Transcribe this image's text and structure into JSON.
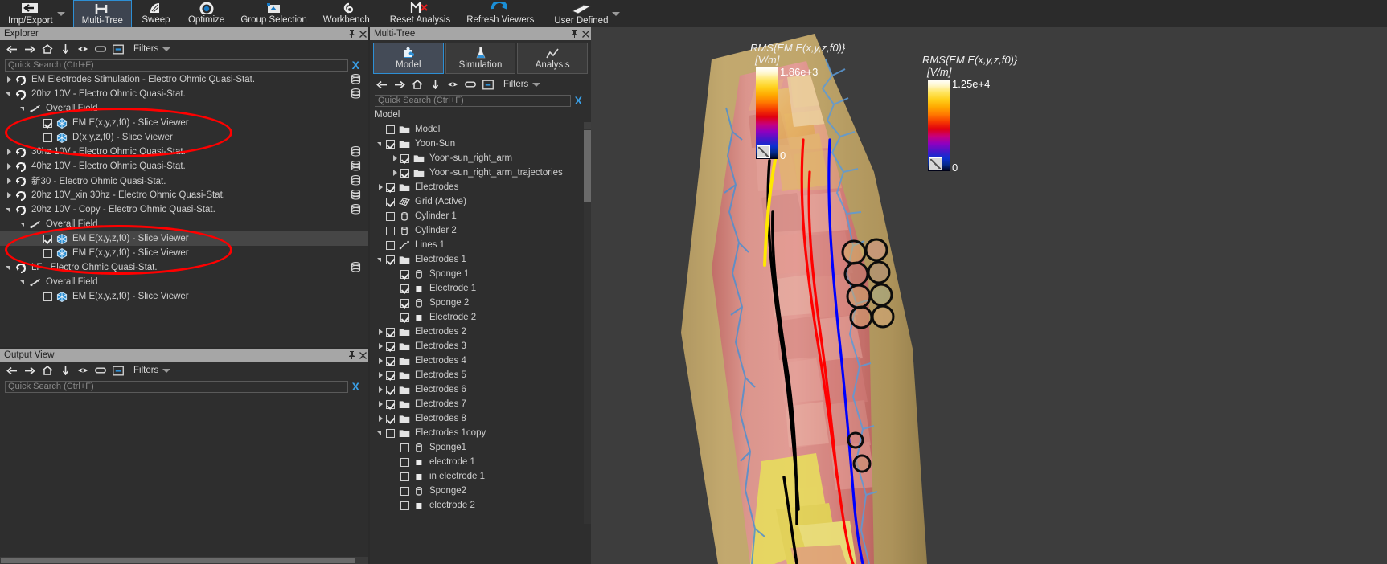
{
  "ribbon": {
    "items": [
      {
        "label": "Imp/Export",
        "icon": "import-export-icon",
        "caret": true,
        "active": false
      },
      {
        "label": "Multi-Tree",
        "icon": "multi-tree-icon",
        "caret": false,
        "active": true
      },
      {
        "label": "Sweep",
        "icon": "sweep-icon",
        "caret": false,
        "active": false
      },
      {
        "label": "Optimize",
        "icon": "optimize-icon",
        "caret": false,
        "active": false
      },
      {
        "label": "Group Selection",
        "icon": "group-selection-icon",
        "caret": false,
        "active": false
      },
      {
        "label": "Workbench",
        "icon": "workbench-icon",
        "caret": false,
        "active": false
      },
      {
        "label": "Reset Analysis",
        "icon": "reset-analysis-icon",
        "caret": false,
        "active": false
      },
      {
        "label": "Refresh Viewers",
        "icon": "refresh-viewers-icon",
        "caret": false,
        "active": false
      },
      {
        "label": "User Defined",
        "icon": "user-defined-icon",
        "caret": true,
        "active": false
      }
    ]
  },
  "explorer": {
    "title": "Explorer",
    "search": {
      "placeholder": "Quick Search (Ctrl+F)",
      "value": "",
      "clear_label": "X"
    },
    "toolbar": {
      "filters_label": "Filters"
    },
    "rows": [
      {
        "indent": 0,
        "twisty": "right",
        "check": "none",
        "icon": "simulation-icon",
        "label": "EM Electrodes Stimulation - Electro Ohmic Quasi-Stat.",
        "db": true,
        "selected": false
      },
      {
        "indent": 0,
        "twisty": "down",
        "check": "none",
        "icon": "simulation-icon",
        "label": "20hz 10V - Electro Ohmic Quasi-Stat.",
        "db": true,
        "selected": false
      },
      {
        "indent": 1,
        "twisty": "down",
        "check": "none",
        "icon": "field-icon",
        "label": "Overall Field",
        "db": false,
        "selected": false
      },
      {
        "indent": 2,
        "twisty": "none",
        "check": "on",
        "icon": "slice-viewer-icon",
        "label": "EM E(x,y,z,f0) - Slice Viewer",
        "db": false,
        "selected": false
      },
      {
        "indent": 2,
        "twisty": "none",
        "check": "off",
        "icon": "slice-viewer-icon",
        "label": "D(x,y,z,f0) - Slice Viewer",
        "db": false,
        "selected": false
      },
      {
        "indent": 0,
        "twisty": "right",
        "check": "none",
        "icon": "simulation-icon",
        "label": "30hz 10V - Electro Ohmic Quasi-Stat.",
        "db": true,
        "selected": false
      },
      {
        "indent": 0,
        "twisty": "right",
        "check": "none",
        "icon": "simulation-icon",
        "label": "40hz 10V  - Electro Ohmic Quasi-Stat.",
        "db": true,
        "selected": false
      },
      {
        "indent": 0,
        "twisty": "right",
        "check": "none",
        "icon": "simulation-icon",
        "label": "新30 - Electro Ohmic Quasi-Stat.",
        "db": true,
        "selected": false
      },
      {
        "indent": 0,
        "twisty": "right",
        "check": "none",
        "icon": "simulation-icon",
        "label": "20hz 10V_xin 30hz - Electro Ohmic Quasi-Stat.",
        "db": true,
        "selected": false
      },
      {
        "indent": 0,
        "twisty": "down",
        "check": "none",
        "icon": "simulation-icon",
        "label": "20hz 10V - Copy - Electro Ohmic Quasi-Stat.",
        "db": true,
        "selected": false
      },
      {
        "indent": 1,
        "twisty": "down",
        "check": "none",
        "icon": "field-icon",
        "label": "Overall Field",
        "db": false,
        "selected": false
      },
      {
        "indent": 2,
        "twisty": "none",
        "check": "on",
        "icon": "slice-viewer-icon",
        "label": "EM E(x,y,z,f0) - Slice Viewer",
        "db": false,
        "selected": true
      },
      {
        "indent": 2,
        "twisty": "none",
        "check": "off",
        "icon": "slice-viewer-icon",
        "label": "EM E(x,y,z,f0) - Slice Viewer",
        "db": false,
        "selected": false
      },
      {
        "indent": 0,
        "twisty": "down",
        "check": "none",
        "icon": "simulation-icon",
        "label": "LF - Electro Ohmic Quasi-Stat.",
        "db": true,
        "selected": false
      },
      {
        "indent": 1,
        "twisty": "down",
        "check": "none",
        "icon": "field-icon",
        "label": "Overall Field",
        "db": false,
        "selected": false
      },
      {
        "indent": 2,
        "twisty": "none",
        "check": "off",
        "icon": "slice-viewer-icon",
        "label": "EM E(x,y,z,f0) - Slice Viewer",
        "db": false,
        "selected": false
      }
    ]
  },
  "output_view": {
    "title": "Output View",
    "search": {
      "placeholder": "Quick Search (Ctrl+F)",
      "value": "",
      "clear_label": "X"
    },
    "toolbar": {
      "filters_label": "Filters"
    }
  },
  "multi_tree": {
    "title": "Multi-Tree",
    "tabs": [
      {
        "label": "Model",
        "icon": "puzzle-icon",
        "active": true
      },
      {
        "label": "Simulation",
        "icon": "flask-icon",
        "active": false
      },
      {
        "label": "Analysis",
        "icon": "analysis-icon",
        "active": false
      }
    ],
    "toolbar": {
      "filters_label": "Filters"
    },
    "search": {
      "placeholder": "Quick Search (Ctrl+F)",
      "value": "",
      "clear_label": "X"
    },
    "header": "Model",
    "rows": [
      {
        "indent": 0,
        "twisty": "none",
        "check": "off",
        "icon": "folder-icon",
        "label": "Model"
      },
      {
        "indent": 0,
        "twisty": "down",
        "check": "on",
        "icon": "folder-icon",
        "label": "Yoon-Sun"
      },
      {
        "indent": 1,
        "twisty": "right",
        "check": "on",
        "icon": "folder-icon",
        "label": "Yoon-sun_right_arm"
      },
      {
        "indent": 1,
        "twisty": "right",
        "check": "on",
        "icon": "folder-icon",
        "label": "Yoon-sun_right_arm_trajectories"
      },
      {
        "indent": 0,
        "twisty": "right",
        "check": "on",
        "icon": "folder-icon",
        "label": "Electrodes"
      },
      {
        "indent": 0,
        "twisty": "none",
        "check": "on",
        "icon": "grid-icon",
        "label": "Grid (Active)"
      },
      {
        "indent": 0,
        "twisty": "none",
        "check": "off",
        "icon": "cylinder-icon",
        "label": "Cylinder 1"
      },
      {
        "indent": 0,
        "twisty": "none",
        "check": "off",
        "icon": "cylinder-icon",
        "label": "Cylinder 2"
      },
      {
        "indent": 0,
        "twisty": "none",
        "check": "off",
        "icon": "lines-icon",
        "label": "Lines 1"
      },
      {
        "indent": 0,
        "twisty": "down",
        "check": "on",
        "icon": "folder-icon",
        "label": "Electrodes 1"
      },
      {
        "indent": 1,
        "twisty": "none",
        "check": "on",
        "icon": "cylinder-icon",
        "label": "Sponge 1"
      },
      {
        "indent": 1,
        "twisty": "none",
        "check": "on",
        "icon": "block-icon",
        "label": "Electrode 1"
      },
      {
        "indent": 1,
        "twisty": "none",
        "check": "on",
        "icon": "cylinder-icon",
        "label": "Sponge 2"
      },
      {
        "indent": 1,
        "twisty": "none",
        "check": "on",
        "icon": "block-icon",
        "label": "Electrode 2"
      },
      {
        "indent": 0,
        "twisty": "right",
        "check": "on",
        "icon": "folder-icon",
        "label": "Electrodes 2"
      },
      {
        "indent": 0,
        "twisty": "right",
        "check": "on",
        "icon": "folder-icon",
        "label": "Electrodes 3"
      },
      {
        "indent": 0,
        "twisty": "right",
        "check": "on",
        "icon": "folder-icon",
        "label": "Electrodes 4"
      },
      {
        "indent": 0,
        "twisty": "right",
        "check": "on",
        "icon": "folder-icon",
        "label": "Electrodes 5"
      },
      {
        "indent": 0,
        "twisty": "right",
        "check": "on",
        "icon": "folder-icon",
        "label": "Electrodes 6"
      },
      {
        "indent": 0,
        "twisty": "right",
        "check": "on",
        "icon": "folder-icon",
        "label": "Electrodes 7"
      },
      {
        "indent": 0,
        "twisty": "right",
        "check": "on",
        "icon": "folder-icon",
        "label": "Electrodes 8"
      },
      {
        "indent": 0,
        "twisty": "down",
        "check": "off",
        "icon": "folder-icon",
        "label": "Electrodes 1copy"
      },
      {
        "indent": 1,
        "twisty": "none",
        "check": "off",
        "icon": "cylinder-icon",
        "label": "Sponge1"
      },
      {
        "indent": 1,
        "twisty": "none",
        "check": "off",
        "icon": "block-icon",
        "label": "electrode 1"
      },
      {
        "indent": 1,
        "twisty": "none",
        "check": "off",
        "icon": "block-icon",
        "label": "in electrode 1"
      },
      {
        "indent": 1,
        "twisty": "none",
        "check": "off",
        "icon": "cylinder-icon",
        "label": "Sponge2"
      },
      {
        "indent": 1,
        "twisty": "none",
        "check": "off",
        "icon": "block-icon",
        "label": "electrode 2"
      }
    ]
  },
  "viewport": {
    "colorbars": [
      {
        "title": "RMS{EM E(x,y,z,f0)}",
        "unit": "[V/m]",
        "max": "1.86e+3",
        "min": "0"
      },
      {
        "title": "RMS{EM E(x,y,z,f0)}",
        "unit": "[V/m]",
        "max": "1.25e+4",
        "min": "0"
      }
    ],
    "colors": {
      "background": "#3d3d3d",
      "accent": "#2d8fd5",
      "annotation": "#ff0000",
      "trajectory_red": "#ff0000",
      "trajectory_blue": "#0000ff",
      "trajectory_black": "#000000",
      "trajectory_yellow": "#ffe800"
    },
    "model_name": "Yoon-sun right arm"
  }
}
